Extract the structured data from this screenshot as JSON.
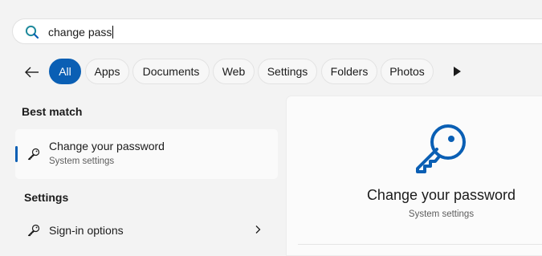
{
  "search": {
    "query": "change pass"
  },
  "filters": {
    "chips": [
      {
        "label": "All",
        "active": true
      },
      {
        "label": "Apps",
        "active": false
      },
      {
        "label": "Documents",
        "active": false
      },
      {
        "label": "Web",
        "active": false
      },
      {
        "label": "Settings",
        "active": false
      },
      {
        "label": "Folders",
        "active": false
      },
      {
        "label": "Photos",
        "active": false
      }
    ]
  },
  "best_match": {
    "heading": "Best match",
    "title": "Change your password",
    "subtitle": "System settings"
  },
  "settings_section": {
    "heading": "Settings",
    "items": [
      {
        "label": "Sign-in options"
      }
    ]
  },
  "preview": {
    "title": "Change your password",
    "subtitle": "System settings"
  },
  "colors": {
    "accent": "#0a5fb4",
    "search_icon_teal": "#1f8a9c",
    "background": "#f3f3f3"
  },
  "icons": {
    "search": "search-icon",
    "back": "arrow-left-icon",
    "more": "play-right-icon",
    "key": "key-icon",
    "chevron": "chevron-right-icon"
  }
}
